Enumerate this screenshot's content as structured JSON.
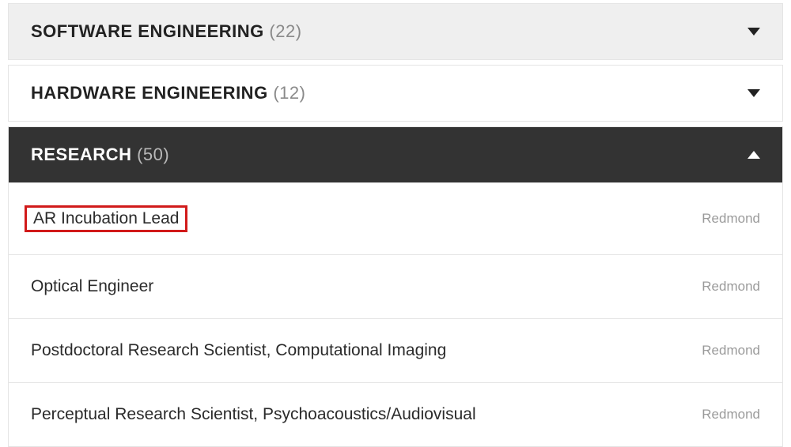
{
  "categories": [
    {
      "name": "SOFTWARE ENGINEERING",
      "count": "22",
      "style": "light",
      "expanded": false
    },
    {
      "name": "HARDWARE ENGINEERING",
      "count": "12",
      "style": "white",
      "expanded": false
    },
    {
      "name": "RESEARCH",
      "count": "50",
      "style": "dark",
      "expanded": true
    }
  ],
  "jobs": [
    {
      "title": "AR Incubation Lead",
      "location": "Redmond",
      "highlighted": true
    },
    {
      "title": "Optical Engineer",
      "location": "Redmond",
      "highlighted": false
    },
    {
      "title": "Postdoctoral Research Scientist, Computational Imaging",
      "location": "Redmond",
      "highlighted": false
    },
    {
      "title": "Perceptual Research Scientist, Psychoacoustics/Audiovisual",
      "location": "Redmond",
      "highlighted": false
    }
  ]
}
